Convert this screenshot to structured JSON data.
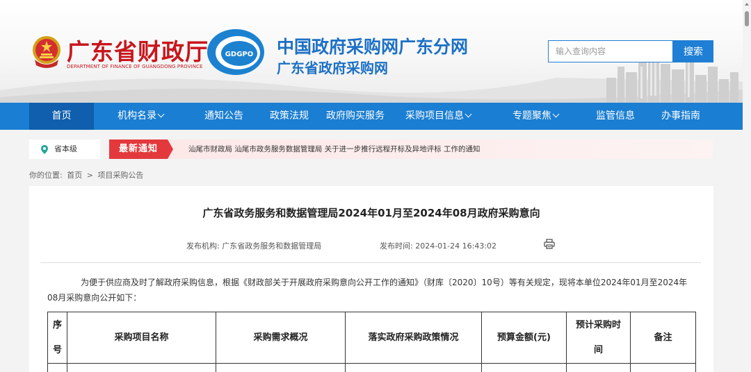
{
  "header": {
    "dept_name": "广东省财政厅",
    "dept_name_en": "DEPARTMENT OF FINANCE OF GUANGDONG PROVINCE",
    "logo_text": "GDGPO",
    "site_title": "中国政府采购网广东分网",
    "site_subtitle": "广东省政府采购网",
    "search_placeholder": "输入查询内容",
    "search_button": "搜索"
  },
  "nav": {
    "items": [
      {
        "label": "首页",
        "active": true
      },
      {
        "label": "机构名录",
        "dropdown": true
      },
      {
        "label": "通知公告"
      },
      {
        "label": "政策法规"
      },
      {
        "label": "政府购买服务"
      },
      {
        "label": "采购项目信息",
        "dropdown": true
      },
      {
        "label": "专题聚焦",
        "dropdown": true
      },
      {
        "label": "监管信息"
      },
      {
        "label": "办事指南"
      }
    ]
  },
  "notice": {
    "region": "省本级",
    "tag": "最新通知",
    "text": "汕尾市财政局 汕尾市政务服务数据管理局 关于进一步推行远程开标及异地评标 工作的通知"
  },
  "breadcrumb": {
    "prefix": "你的位置:",
    "home": "首页",
    "separator": ">",
    "current": "项目采购公告"
  },
  "article": {
    "title": "广东省政务服务和数据管理局2024年01月至2024年08月政府采购意向",
    "publisher_label": "发布机构:",
    "publisher": "广东省政务服务和数据管理局",
    "time_label": "发布时间:",
    "time": "2024-01-24 16:43:02",
    "paragraph": "为便于供应商及时了解政府采购信息，根据《财政部关于开展政府采购意向公开工作的通知》（财库〔2020〕10号）等有关规定，现将本单位2024年01月至2024年08月采购意向公开如下："
  },
  "table": {
    "headers": [
      {
        "line1": "序",
        "line2": "号"
      },
      {
        "line1": "采购项目名称"
      },
      {
        "line1": "采购需求概况"
      },
      {
        "line1": "落实政府采购政策情况"
      },
      {
        "line1": "预算金额(元)"
      },
      {
        "line1": "预计采购时",
        "line2": "间"
      },
      {
        "line1": "备注"
      }
    ]
  },
  "colors": {
    "brand_red": "#c8161d",
    "site_blue": "#1c70c6",
    "nav_blue": "#1a7ed2",
    "nav_active": "#0f5fae",
    "notice_red": "#e4393c"
  }
}
